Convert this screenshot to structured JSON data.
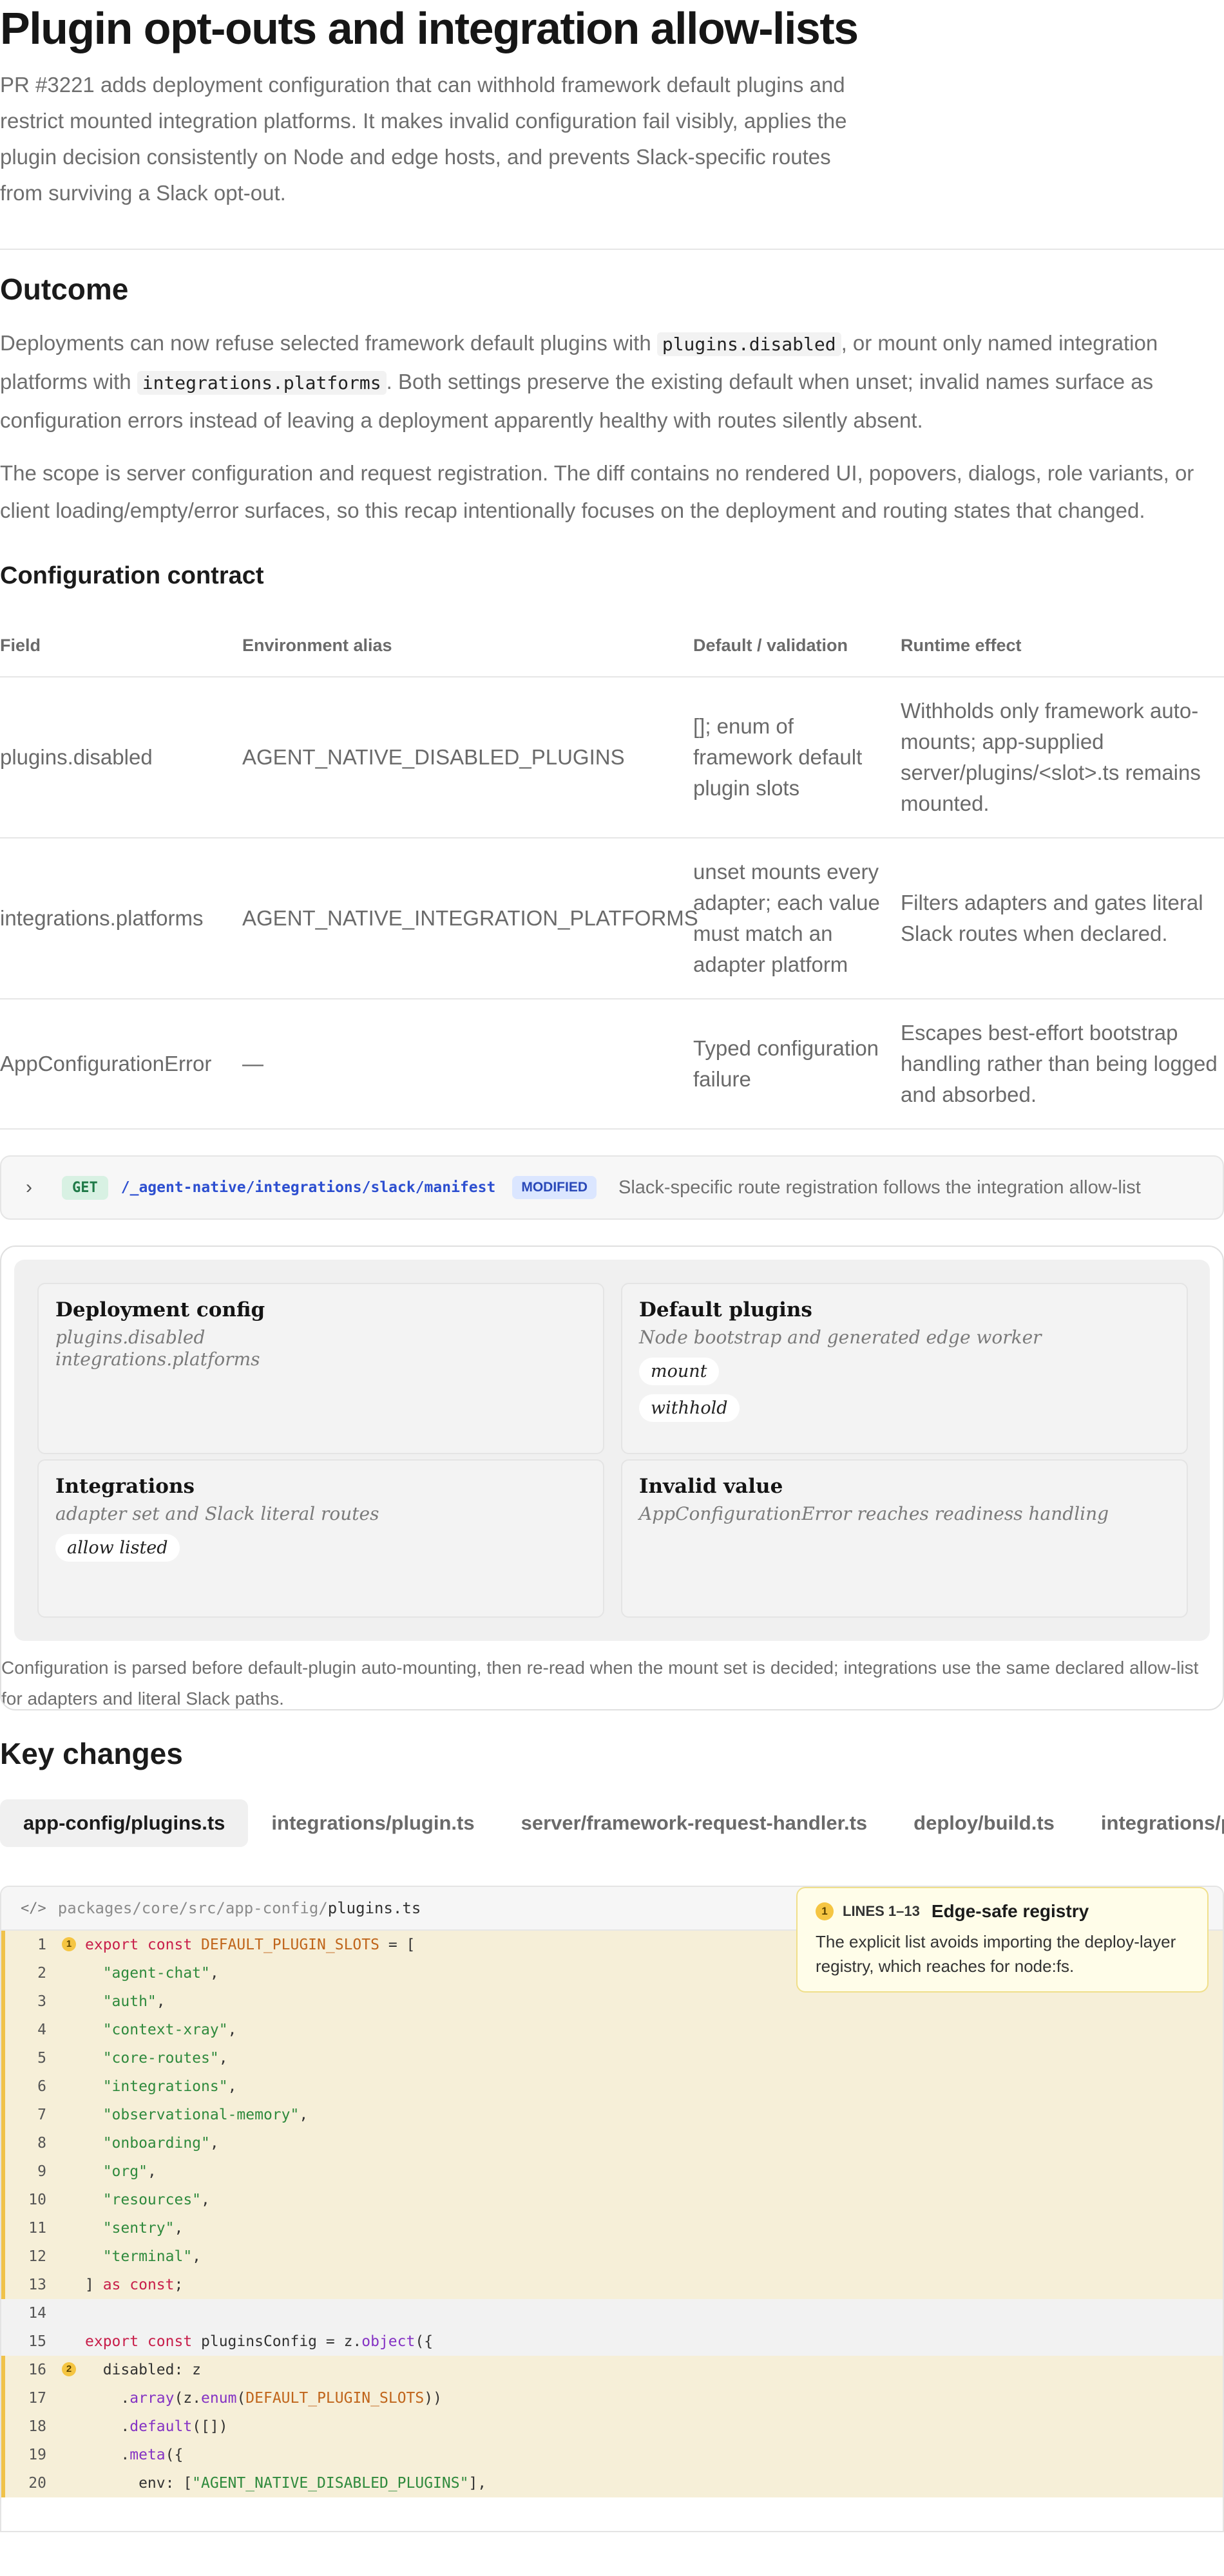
{
  "page": {
    "title": "Plugin opt-outs and integration allow-lists",
    "lead": "PR #3221 adds deployment configuration that can withhold framework default plugins and restrict mounted integration platforms. It makes invalid configuration fail visibly, applies the plugin decision consistently on Node and edge hosts, and prevents Slack-specific routes from surviving a Slack opt-out."
  },
  "outcome": {
    "heading": "Outcome",
    "p1_a": "Deployments can now refuse selected framework default plugins with ",
    "p1_code1": "plugins.disabled",
    "p1_b": ", or mount only named integration platforms with ",
    "p1_code2": "integrations.platforms",
    "p1_c": ". Both settings preserve the existing default when unset; invalid names surface as configuration errors instead of leaving a deployment apparently healthy with routes silently absent.",
    "p2": "The scope is server configuration and request registration. The diff contains no rendered UI, popovers, dialogs, role variants, or client loading/empty/error surfaces, so this recap intentionally focuses on the deployment and routing states that changed."
  },
  "contract": {
    "heading": "Configuration contract",
    "columns": [
      "Field",
      "Environment alias",
      "Default / validation",
      "Runtime effect"
    ],
    "rows": [
      [
        "plugins.disabled",
        "AGENT_NATIVE_DISABLED_PLUGINS",
        "[]; enum of framework default plugin slots",
        "Withholds only framework auto-mounts; app-supplied server/plugins/<slot>.ts remains mounted."
      ],
      [
        "integrations.platforms",
        "AGENT_NATIVE_INTEGRATION_PLATFORMS",
        "unset mounts every adapter; each value must match an adapter platform",
        "Filters adapters and gates literal Slack routes when declared."
      ],
      [
        "AppConfigurationError",
        "—",
        "Typed configuration failure",
        "Escapes best-effort bootstrap handling rather than being logged and absorbed."
      ]
    ]
  },
  "route": {
    "method": "GET",
    "path": "/_agent-native/integrations/slack/manifest",
    "status": "MODIFIED",
    "description": "Slack-specific route registration follows the integration allow-list"
  },
  "diagram": {
    "boxes": [
      {
        "title": "Deployment config",
        "text": "plugins.disabled\nintegrations.platforms",
        "pills": []
      },
      {
        "title": "Default plugins",
        "text": "Node bootstrap and generated edge worker",
        "pills": [
          "mount",
          "withhold"
        ]
      },
      {
        "title": "Integrations",
        "text": "adapter set and Slack literal routes",
        "pills": [
          "allow listed"
        ]
      },
      {
        "title": "Invalid value",
        "text": "AppConfigurationError reaches readiness handling",
        "pills": []
      }
    ],
    "caption": "Configuration is parsed before default-plugin auto-mounting, then re-read when the mount set is decided; integrations use the same declared allow-list for adapters and literal Slack paths."
  },
  "changes": {
    "heading": "Key changes",
    "tabs": [
      "app-config/plugins.ts",
      "integrations/plugin.ts",
      "server/framework-request-handler.ts",
      "deploy/build.ts",
      "integrations/plug"
    ]
  },
  "code": {
    "path_prefix": "packages/core/src/app-config/",
    "file": "plugins.ts",
    "note": {
      "badge": "1",
      "lines": "LINES 1–13",
      "title": "Edge-safe registry",
      "body": "The explicit list avoids importing the deploy-layer registry, which reaches for node:fs."
    }
  }
}
